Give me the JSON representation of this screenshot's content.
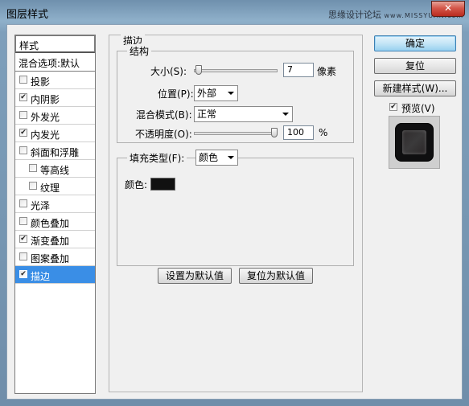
{
  "window": {
    "title": "图层样式",
    "watermark": "思缘设计论坛",
    "watermark_site": "www.MISSYUAN.com",
    "close_glyph": "✕"
  },
  "style_list": {
    "header": "样式",
    "blend_default": "混合选项:默认",
    "items": [
      {
        "label": "投影",
        "checked": false,
        "sub": false
      },
      {
        "label": "内阴影",
        "checked": true,
        "sub": false
      },
      {
        "label": "外发光",
        "checked": false,
        "sub": false
      },
      {
        "label": "内发光",
        "checked": true,
        "sub": false
      },
      {
        "label": "斜面和浮雕",
        "checked": false,
        "sub": false
      },
      {
        "label": "等高线",
        "checked": false,
        "sub": true
      },
      {
        "label": "纹理",
        "checked": false,
        "sub": true
      },
      {
        "label": "光泽",
        "checked": false,
        "sub": false
      },
      {
        "label": "颜色叠加",
        "checked": false,
        "sub": false
      },
      {
        "label": "渐变叠加",
        "checked": true,
        "sub": false
      },
      {
        "label": "图案叠加",
        "checked": false,
        "sub": false
      },
      {
        "label": "描边",
        "checked": true,
        "sub": false,
        "active": true
      }
    ]
  },
  "stroke": {
    "section_title": "描边",
    "structure_title": "结构",
    "size_label": "大小(S):",
    "size_value": "7",
    "size_unit": "像素",
    "size_slider_fraction": 0.02,
    "position_label": "位置(P):",
    "position_value": "外部",
    "blend_label": "混合模式(B):",
    "blend_value": "正常",
    "opacity_label": "不透明度(O):",
    "opacity_value": "100",
    "opacity_unit": "%",
    "opacity_slider_fraction": 1.0,
    "fill_type_label": "填充类型(F):",
    "fill_type_value": "颜色",
    "color_label": "颜色:",
    "color_value": "#111111"
  },
  "buttons": {
    "ok": "确定",
    "reset": "复位",
    "new_style": "新建样式(W)...",
    "preview_label": "预览(V)",
    "preview_checked": true,
    "make_default": "设置为默认值",
    "reset_default": "复位为默认值"
  }
}
